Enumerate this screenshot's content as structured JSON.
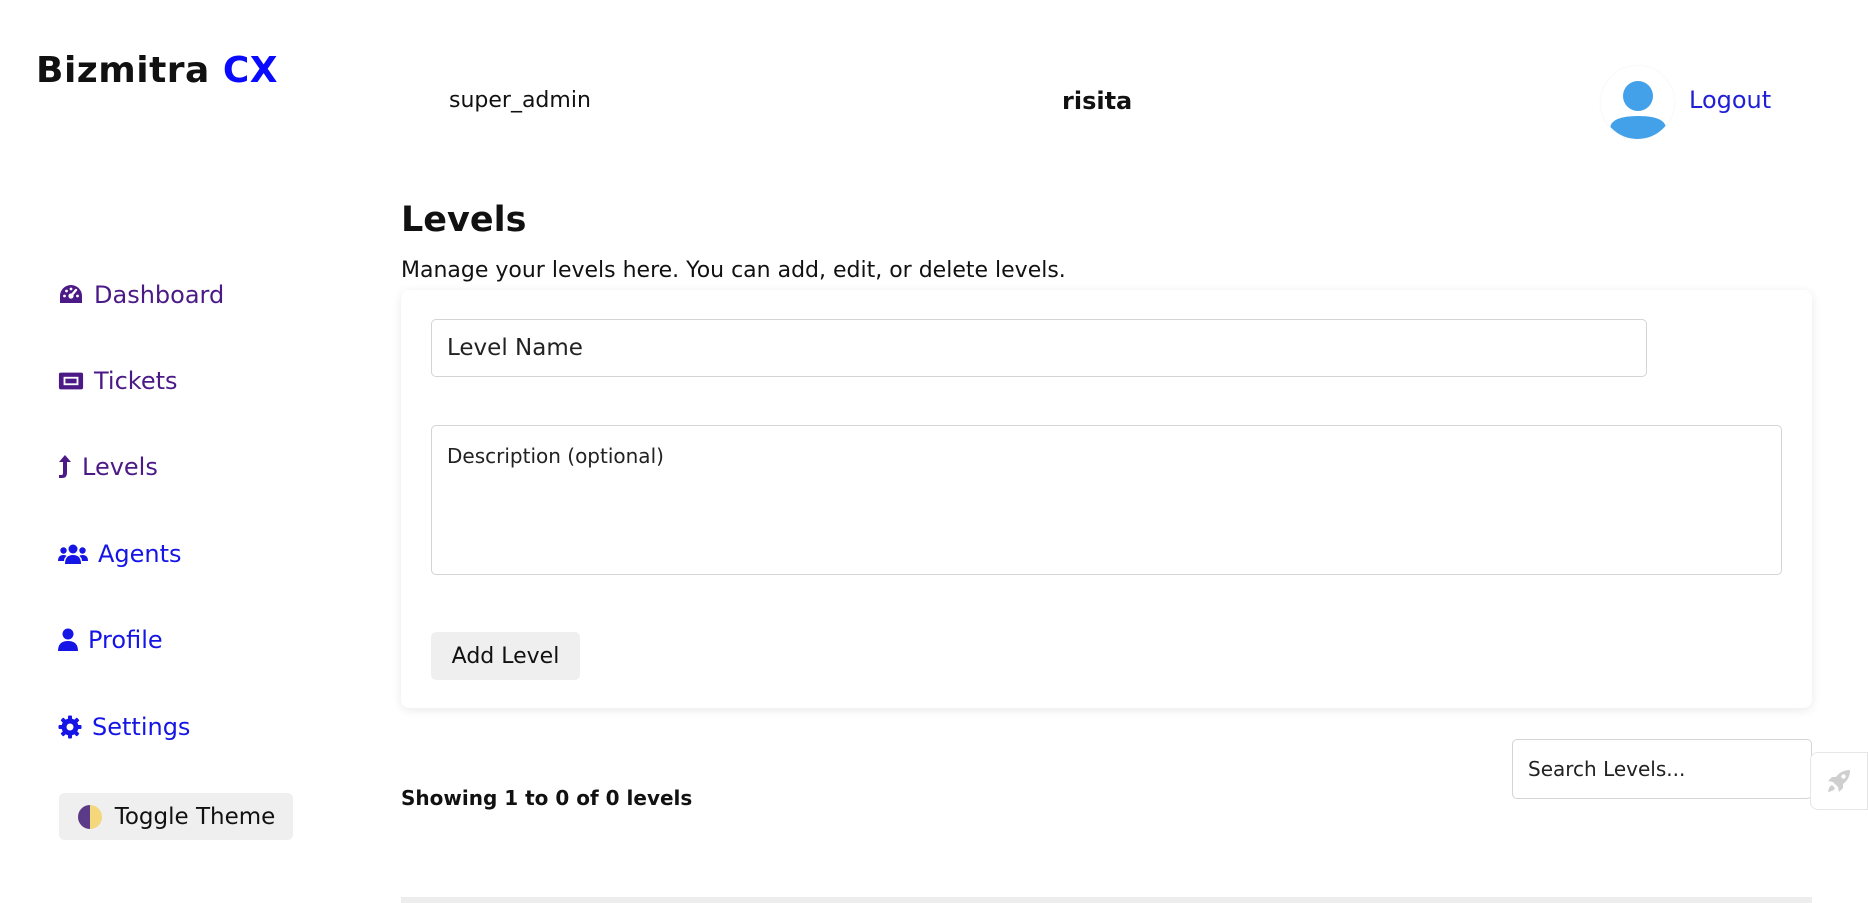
{
  "brand": {
    "name": "Bizmitra",
    "accent": "CX",
    "accent_color": "#0a0aff"
  },
  "header": {
    "role": "super_admin",
    "username": "risita",
    "avatar_icon": "user-avatar-icon",
    "logout_label": "Logout"
  },
  "sidebar": {
    "items": [
      {
        "label": "Dashboard",
        "icon": "gauge-icon",
        "color": "#4b1a86"
      },
      {
        "label": "Tickets",
        "icon": "ticket-icon",
        "color": "#4b1a86"
      },
      {
        "label": "Levels",
        "icon": "arrow-up-icon",
        "color": "#4b1a86"
      },
      {
        "label": "Agents",
        "icon": "users-icon",
        "color": "#1515e6"
      },
      {
        "label": "Profile",
        "icon": "user-icon",
        "color": "#1515e6"
      },
      {
        "label": "Settings",
        "icon": "gear-icon",
        "color": "#1515e6"
      }
    ],
    "toggle_theme_label": "Toggle Theme"
  },
  "main": {
    "title": "Levels",
    "description": "Manage your levels here. You can add, edit, or delete levels.",
    "form": {
      "name_placeholder": "Level Name",
      "description_placeholder": "Description (optional)",
      "submit_label": "Add Level"
    },
    "showing_text": "Showing 1 to 0 of 0 levels",
    "search_placeholder": "Search Levels..."
  }
}
